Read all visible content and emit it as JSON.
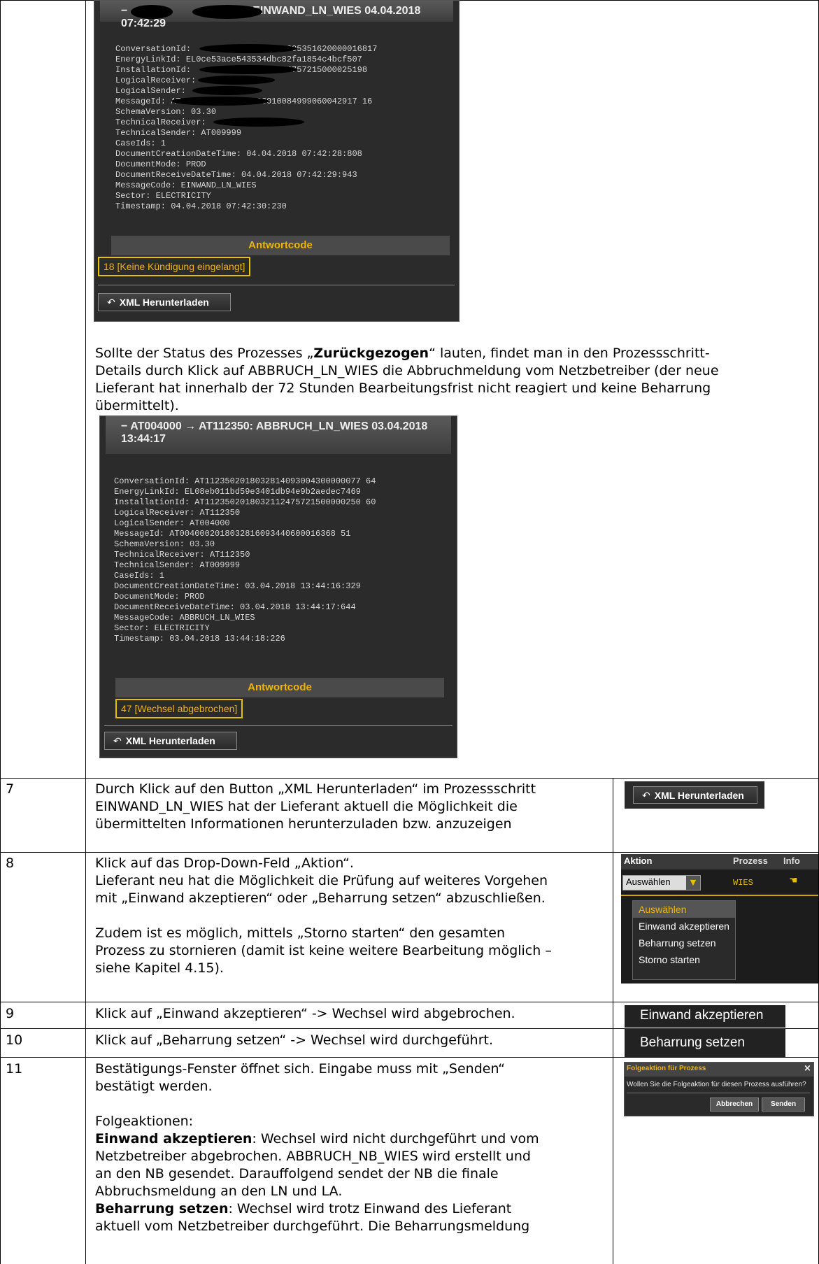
{
  "panel1": {
    "title": "EINWAND_LN_WIES 04.04.2018 07:42:29",
    "title_prefix": "−",
    "lines": [
      "ConversationId:           01803300805351620000016817",
      "EnergyLinkId: EL0ce53ace543534dbc82fa1854c4bcf507",
      "InstallationId:          0180321124757215000025198",
      "LogicalReceiver:",
      "LogicalSender:",
      "MessageId: AT           018033010084999060042917 16",
      "SchemaVersion: 03.30",
      "TechnicalReceiver:",
      "TechnicalSender: AT009999",
      "CaseIds: 1",
      "DocumentCreationDateTime: 04.04.2018 07:42:28:808",
      "DocumentMode: PROD",
      "DocumentReceiveDateTime: 04.04.2018 07:42:29:943",
      "MessageCode: EINWAND_LN_WIES",
      "Sector: ELECTRICITY",
      "Timestamp: 04.04.2018 07:42:30:230"
    ],
    "antwortcode_label": "Antwortcode",
    "antwortcode_value": "18 [Keine Kündigung eingelangt]",
    "xml_button": "XML Herunterladen"
  },
  "para1": {
    "pre": "Sollte der Status des Prozesses „",
    "bold": "Zurückgezogen",
    "post_line1": "“ lauten, findet man in den Prozessschritt-",
    "line2": "Details durch Klick auf ABBRUCH_LN_WIES die Abbruchmeldung vom Netzbetreiber (der neue",
    "line3": "Lieferant hat innerhalb der 72 Stunden Bearbeitungsfrist nicht reagiert und keine Beharrung",
    "line4": "übermittelt)."
  },
  "panel2": {
    "title_line1": "− AT004000 → AT112350: ABBRUCH_LN_WIES 03.04.2018",
    "title_line2": "13:44:17",
    "lines": [
      "ConversationId: AT1123502018032814093004300000077 64",
      "EnergyLinkId: EL08eb011bd59e3401db94e9b2aedec7469",
      "InstallationId: AT1123502018032112475721500000250 60",
      "LogicalReceiver: AT112350",
      "LogicalSender: AT004000",
      "MessageId: AT0040002018032816093440600016368 51",
      "SchemaVersion: 03.30",
      "TechnicalReceiver: AT112350",
      "TechnicalSender: AT009999",
      "CaseIds: 1",
      "DocumentCreationDateTime: 03.04.2018 13:44:16:329",
      "DocumentMode: PROD",
      "DocumentReceiveDateTime: 03.04.2018 13:44:17:644",
      "MessageCode: ABBRUCH_LN_WIES",
      "Sector: ELECTRICITY",
      "Timestamp: 03.04.2018 13:44:18:226"
    ],
    "antwortcode_label": "Antwortcode",
    "antwortcode_value": "47 [Wechsel abgebrochen]",
    "xml_button": "XML Herunterladen"
  },
  "rows": {
    "r7": {
      "num": "7",
      "l1": "Durch Klick auf den Button „XML Herunterladen“ im Prozessschritt",
      "l2": "EINWAND_LN_WIES hat der Lieferant aktuell die Möglichkeit die",
      "l3": "übermittelten Informationen herunterzuladen bzw. anzuzeigen",
      "button": "XML Herunterladen"
    },
    "r8": {
      "num": "8",
      "l1": "Klick auf das Drop-Down-Feld „Aktion“.",
      "l2": "Lieferant neu hat die Möglichkeit die Prüfung auf weiteres Vorgehen",
      "l3": "mit „Einwand akzeptieren“ oder „Beharrung setzen“ abzuschließen.",
      "l4": "Zudem ist es möglich, mittels „Storno starten“ den gesamten",
      "l5": "Prozess zu stornieren (damit ist keine weitere Bearbeitung möglich –",
      "l6": "siehe Kapitel 4.15).",
      "hdr_aktion": "Aktion",
      "hdr_prozess": "Prozess",
      "hdr_info": "Info",
      "select_value": "Auswählen",
      "wies": "WIES",
      "menu": [
        "Auswählen",
        "Einwand akzeptieren",
        "Beharrung setzen",
        "Storno starten"
      ]
    },
    "r9": {
      "num": "9",
      "text": "Klick auf „Einwand akzeptieren“ -> Wechsel wird abgebrochen.",
      "img": "Einwand akzeptieren"
    },
    "r10": {
      "num": "10",
      "text": "Klick auf „Beharrung setzen“ -> Wechsel wird durchgeführt.",
      "img": "Beharrung setzen"
    },
    "r11": {
      "num": "11",
      "l1": "Bestätigungs-Fenster öffnet sich. Eingabe muss mit „Senden“",
      "l2": "bestätigt werden.",
      "l3": "Folgeaktionen:",
      "b1": "Einwand akzeptieren",
      "l4": ": Wechsel wird nicht durchgeführt und vom",
      "l5": "Netzbetreiber abgebrochen. ABBRUCH_NB_WIES wird erstellt und",
      "l6": "an den NB gesendet. Darauffolgend sendet der NB die finale",
      "l7": "Abbruchsmeldung an den LN und LA.",
      "b2": "Beharrung setzen",
      "l8": ": Wechsel wird trotz Einwand des Lieferant",
      "l9": "aktuell vom Netzbetreiber durchgeführt. Die Beharrungsmeldung",
      "dlg_title": "Folgeaktion für Prozess",
      "dlg_close": "×",
      "dlg_text": "Wollen Sie die Folgeaktion für diesen Prozess ausführen?",
      "dlg_cancel": "Abbrechen",
      "dlg_send": "Senden"
    }
  }
}
